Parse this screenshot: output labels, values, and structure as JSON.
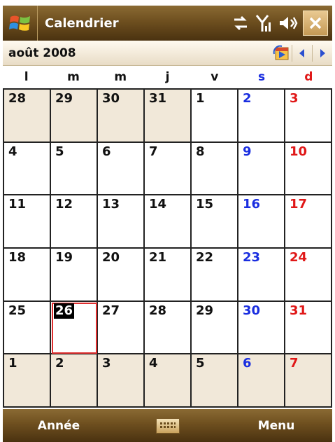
{
  "titlebar": {
    "title": "Calendrier"
  },
  "monthbar": {
    "month": "août 2008"
  },
  "weekdays": [
    {
      "label": "l",
      "kind": "weekday"
    },
    {
      "label": "m",
      "kind": "weekday"
    },
    {
      "label": "m",
      "kind": "weekday"
    },
    {
      "label": "j",
      "kind": "weekday"
    },
    {
      "label": "v",
      "kind": "weekday"
    },
    {
      "label": "s",
      "kind": "sat"
    },
    {
      "label": "d",
      "kind": "sun"
    }
  ],
  "weeks": [
    [
      {
        "d": "28",
        "other": true
      },
      {
        "d": "29",
        "other": true
      },
      {
        "d": "30",
        "other": true
      },
      {
        "d": "31",
        "other": true
      },
      {
        "d": "1"
      },
      {
        "d": "2"
      },
      {
        "d": "3"
      }
    ],
    [
      {
        "d": "4"
      },
      {
        "d": "5"
      },
      {
        "d": "6"
      },
      {
        "d": "7"
      },
      {
        "d": "8"
      },
      {
        "d": "9"
      },
      {
        "d": "10"
      }
    ],
    [
      {
        "d": "11"
      },
      {
        "d": "12"
      },
      {
        "d": "13"
      },
      {
        "d": "14"
      },
      {
        "d": "15"
      },
      {
        "d": "16"
      },
      {
        "d": "17"
      }
    ],
    [
      {
        "d": "18"
      },
      {
        "d": "19"
      },
      {
        "d": "20"
      },
      {
        "d": "21"
      },
      {
        "d": "22"
      },
      {
        "d": "23"
      },
      {
        "d": "24"
      }
    ],
    [
      {
        "d": "25"
      },
      {
        "d": "26",
        "today": true
      },
      {
        "d": "27"
      },
      {
        "d": "28"
      },
      {
        "d": "29"
      },
      {
        "d": "30"
      },
      {
        "d": "31"
      }
    ],
    [
      {
        "d": "1",
        "other": true
      },
      {
        "d": "2",
        "other": true
      },
      {
        "d": "3",
        "other": true
      },
      {
        "d": "4",
        "other": true
      },
      {
        "d": "5",
        "other": true
      },
      {
        "d": "6",
        "other": true
      },
      {
        "d": "7",
        "other": true
      }
    ]
  ],
  "softkeys": {
    "left": "Année",
    "right": "Menu"
  },
  "colors": {
    "saturday": "#1a2ee0",
    "sunday": "#e01818",
    "today_border": "#e03030"
  }
}
